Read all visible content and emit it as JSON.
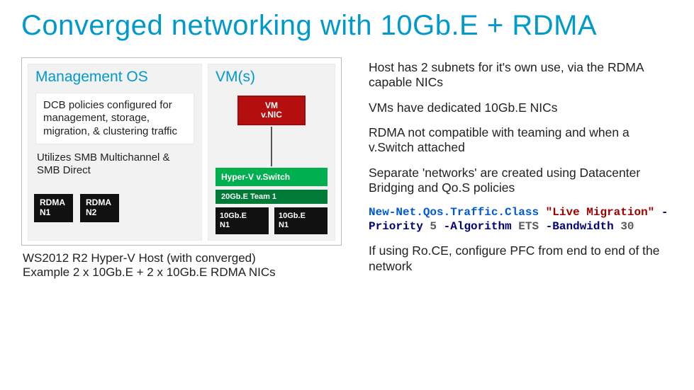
{
  "title": "Converged networking with 10Gb.E + RDMA",
  "diagram": {
    "mgmt_head": "Management OS",
    "vms_head": "VM(s)",
    "dcb_text": "DCB policies configured for management, storage, migration, & clustering traffic",
    "smb_text": "Utilizes SMB Multichannel & SMB Direct",
    "vm_nic_l1": "VM",
    "vm_nic_l2": "v.NIC",
    "vswitch": "Hyper-V v.Switch",
    "team": "20Gb.E Team 1",
    "rdma1_l1": "RDMA",
    "rdma1_l2": "N1",
    "rdma2_l1": "RDMA",
    "rdma2_l2": "N2",
    "nic1_l1": "10Gb.E",
    "nic1_l2": "N1",
    "nic2_l1": "10Gb.E",
    "nic2_l2": "N1",
    "caption_l1": "WS2012 R2 Hyper-V Host (with converged)",
    "caption_l2": "Example 2 x 10Gb.E + 2 x 10Gb.E RDMA NICs"
  },
  "bullets": {
    "b1": "Host has 2 subnets for it's own use, via the RDMA capable NICs",
    "b2": "VMs have dedicated 10Gb.E NICs",
    "b3": "RDMA not compatible with teaming and when a v.Switch attached",
    "b4": "Separate 'networks' are created using Datacenter Bridging and Qo.S policies",
    "b6": "If using Ro.CE, configure PFC from end to end of the network"
  },
  "code": {
    "t1": "New-Net.Qos.Traffic.Class",
    "t2": "\"Live Migration\"",
    "t3": "-Priority",
    "t4": "5",
    "t5": "-Algorithm",
    "t6": "ETS",
    "t7": "-Bandwidth",
    "t8": "30"
  }
}
